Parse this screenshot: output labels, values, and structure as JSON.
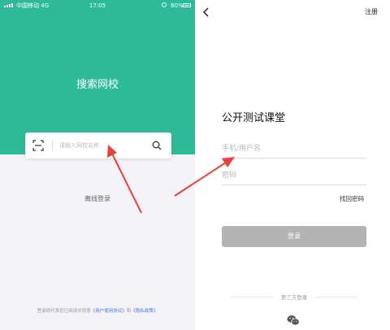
{
  "left_screen": {
    "status_bar": {
      "carrier": "中国移动",
      "network": "4G",
      "time": "17:05",
      "battery": "80%"
    },
    "hero_title": "搜索网校",
    "search": {
      "placeholder": "请输入网校名称"
    },
    "offline_login": "离线登录",
    "agreement": {
      "prefix": "登录即代表您已阅读并同意",
      "terms": "《用户使用协议》",
      "and": "和",
      "privacy": "《隐私政策》"
    }
  },
  "right_screen": {
    "register": "注册",
    "title": "公开测试课堂",
    "username_placeholder": "手机/用户名",
    "password_placeholder": "密码",
    "forgot_password": "找回密码",
    "login_button": "登录",
    "third_party": "第三方登录"
  },
  "colors": {
    "hero": "#2dbb97",
    "annotation_arrow": "#e8413a",
    "button_disabled": "#b3b3b3"
  },
  "icons": [
    "signal-icon",
    "alarm-icon",
    "battery-icon",
    "scan-icon",
    "search-icon",
    "back-icon",
    "wechat-icon",
    "arrow-annotation"
  ]
}
